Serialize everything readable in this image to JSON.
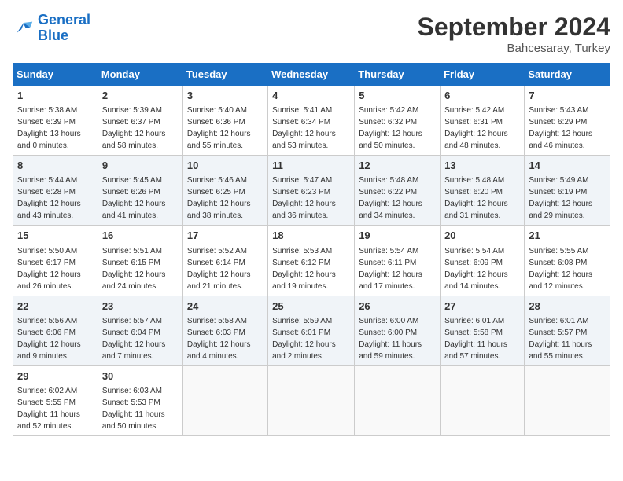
{
  "logo": {
    "text_general": "General",
    "text_blue": "Blue"
  },
  "header": {
    "month": "September 2024",
    "location": "Bahcesaray, Turkey"
  },
  "days_of_week": [
    "Sunday",
    "Monday",
    "Tuesday",
    "Wednesday",
    "Thursday",
    "Friday",
    "Saturday"
  ],
  "weeks": [
    {
      "row_index": 0,
      "cells": [
        {
          "day": "1",
          "sunrise": "5:38 AM",
          "sunset": "6:39 PM",
          "daylight": "13 hours and 0 minutes."
        },
        {
          "day": "2",
          "sunrise": "5:39 AM",
          "sunset": "6:37 PM",
          "daylight": "12 hours and 58 minutes."
        },
        {
          "day": "3",
          "sunrise": "5:40 AM",
          "sunset": "6:36 PM",
          "daylight": "12 hours and 55 minutes."
        },
        {
          "day": "4",
          "sunrise": "5:41 AM",
          "sunset": "6:34 PM",
          "daylight": "12 hours and 53 minutes."
        },
        {
          "day": "5",
          "sunrise": "5:42 AM",
          "sunset": "6:32 PM",
          "daylight": "12 hours and 50 minutes."
        },
        {
          "day": "6",
          "sunrise": "5:42 AM",
          "sunset": "6:31 PM",
          "daylight": "12 hours and 48 minutes."
        },
        {
          "day": "7",
          "sunrise": "5:43 AM",
          "sunset": "6:29 PM",
          "daylight": "12 hours and 46 minutes."
        }
      ]
    },
    {
      "row_index": 1,
      "cells": [
        {
          "day": "8",
          "sunrise": "5:44 AM",
          "sunset": "6:28 PM",
          "daylight": "12 hours and 43 minutes."
        },
        {
          "day": "9",
          "sunrise": "5:45 AM",
          "sunset": "6:26 PM",
          "daylight": "12 hours and 41 minutes."
        },
        {
          "day": "10",
          "sunrise": "5:46 AM",
          "sunset": "6:25 PM",
          "daylight": "12 hours and 38 minutes."
        },
        {
          "day": "11",
          "sunrise": "5:47 AM",
          "sunset": "6:23 PM",
          "daylight": "12 hours and 36 minutes."
        },
        {
          "day": "12",
          "sunrise": "5:48 AM",
          "sunset": "6:22 PM",
          "daylight": "12 hours and 34 minutes."
        },
        {
          "day": "13",
          "sunrise": "5:48 AM",
          "sunset": "6:20 PM",
          "daylight": "12 hours and 31 minutes."
        },
        {
          "day": "14",
          "sunrise": "5:49 AM",
          "sunset": "6:19 PM",
          "daylight": "12 hours and 29 minutes."
        }
      ]
    },
    {
      "row_index": 2,
      "cells": [
        {
          "day": "15",
          "sunrise": "5:50 AM",
          "sunset": "6:17 PM",
          "daylight": "12 hours and 26 minutes."
        },
        {
          "day": "16",
          "sunrise": "5:51 AM",
          "sunset": "6:15 PM",
          "daylight": "12 hours and 24 minutes."
        },
        {
          "day": "17",
          "sunrise": "5:52 AM",
          "sunset": "6:14 PM",
          "daylight": "12 hours and 21 minutes."
        },
        {
          "day": "18",
          "sunrise": "5:53 AM",
          "sunset": "6:12 PM",
          "daylight": "12 hours and 19 minutes."
        },
        {
          "day": "19",
          "sunrise": "5:54 AM",
          "sunset": "6:11 PM",
          "daylight": "12 hours and 17 minutes."
        },
        {
          "day": "20",
          "sunrise": "5:54 AM",
          "sunset": "6:09 PM",
          "daylight": "12 hours and 14 minutes."
        },
        {
          "day": "21",
          "sunrise": "5:55 AM",
          "sunset": "6:08 PM",
          "daylight": "12 hours and 12 minutes."
        }
      ]
    },
    {
      "row_index": 3,
      "cells": [
        {
          "day": "22",
          "sunrise": "5:56 AM",
          "sunset": "6:06 PM",
          "daylight": "12 hours and 9 minutes."
        },
        {
          "day": "23",
          "sunrise": "5:57 AM",
          "sunset": "6:04 PM",
          "daylight": "12 hours and 7 minutes."
        },
        {
          "day": "24",
          "sunrise": "5:58 AM",
          "sunset": "6:03 PM",
          "daylight": "12 hours and 4 minutes."
        },
        {
          "day": "25",
          "sunrise": "5:59 AM",
          "sunset": "6:01 PM",
          "daylight": "12 hours and 2 minutes."
        },
        {
          "day": "26",
          "sunrise": "6:00 AM",
          "sunset": "6:00 PM",
          "daylight": "11 hours and 59 minutes."
        },
        {
          "day": "27",
          "sunrise": "6:01 AM",
          "sunset": "5:58 PM",
          "daylight": "11 hours and 57 minutes."
        },
        {
          "day": "28",
          "sunrise": "6:01 AM",
          "sunset": "5:57 PM",
          "daylight": "11 hours and 55 minutes."
        }
      ]
    },
    {
      "row_index": 4,
      "cells": [
        {
          "day": "29",
          "sunrise": "6:02 AM",
          "sunset": "5:55 PM",
          "daylight": "11 hours and 52 minutes."
        },
        {
          "day": "30",
          "sunrise": "6:03 AM",
          "sunset": "5:53 PM",
          "daylight": "11 hours and 50 minutes."
        },
        null,
        null,
        null,
        null,
        null
      ]
    }
  ],
  "labels": {
    "sunrise": "Sunrise:",
    "sunset": "Sunset:",
    "daylight": "Daylight:"
  }
}
